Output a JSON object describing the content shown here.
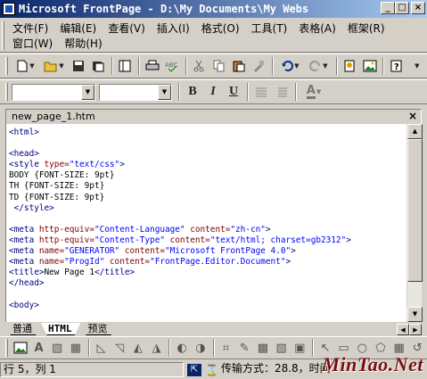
{
  "window": {
    "title": "Microsoft FrontPage - D:\\My Documents\\My Webs",
    "minimize": "_",
    "maximize": "□",
    "close": "×"
  },
  "menu": {
    "row1": [
      "文件(F)",
      "编辑(E)",
      "查看(V)",
      "插入(I)",
      "格式(O)",
      "工具(T)",
      "表格(A)",
      "框架(R)"
    ],
    "row2": [
      "窗口(W)",
      "帮助(H)"
    ]
  },
  "format_toolbar": {
    "bold": "B",
    "italic": "I",
    "underline": "U",
    "font_color": "A"
  },
  "document": {
    "tab_title": "new_page_1.htm",
    "close": "×"
  },
  "code_lines": [
    [
      [
        "tag",
        "<html>"
      ]
    ],
    [],
    [
      [
        "tag",
        "<head>"
      ]
    ],
    [
      [
        "tag",
        "<style "
      ],
      [
        "attr",
        "type="
      ],
      [
        "val",
        "\"text/css\""
      ],
      [
        "tag",
        ">"
      ]
    ],
    [
      [
        "txt",
        "BODY {FONT-SIZE: 9pt}"
      ]
    ],
    [
      [
        "txt",
        "TH {FONT-SIZE: 9pt}"
      ]
    ],
    [
      [
        "txt",
        "TD {FONT-SIZE: 9pt}"
      ]
    ],
    [
      [
        "tag",
        " </style>"
      ]
    ],
    [],
    [
      [
        "tag",
        "<meta "
      ],
      [
        "attr",
        "http-equiv="
      ],
      [
        "val",
        "\"Content-Language\""
      ],
      [
        "attr",
        " content="
      ],
      [
        "val",
        "\"zh-cn\""
      ],
      [
        "tag",
        ">"
      ]
    ],
    [
      [
        "tag",
        "<meta "
      ],
      [
        "attr",
        "http-equiv="
      ],
      [
        "val",
        "\"Content-Type\""
      ],
      [
        "attr",
        " content="
      ],
      [
        "val",
        "\"text/html; charset=gb2312\""
      ],
      [
        "tag",
        ">"
      ]
    ],
    [
      [
        "tag",
        "<meta "
      ],
      [
        "attr",
        "name="
      ],
      [
        "val",
        "\"GENERATOR\""
      ],
      [
        "attr",
        " content="
      ],
      [
        "val",
        "\"Microsoft FrontPage 4.0\""
      ],
      [
        "tag",
        ">"
      ]
    ],
    [
      [
        "tag",
        "<meta "
      ],
      [
        "attr",
        "name="
      ],
      [
        "val",
        "\"ProgId\""
      ],
      [
        "attr",
        " content="
      ],
      [
        "val",
        "\"FrontPage.Editor.Document\""
      ],
      [
        "tag",
        ">"
      ]
    ],
    [
      [
        "tag",
        "<title>"
      ],
      [
        "txt",
        "New Page 1"
      ],
      [
        "tag",
        "</title>"
      ]
    ],
    [
      [
        "tag",
        "</head>"
      ]
    ],
    [],
    [
      [
        "tag",
        "<body>"
      ]
    ]
  ],
  "view_tabs": [
    "普通",
    "HTML",
    "预览"
  ],
  "active_view": "HTML",
  "status": {
    "position": "行 5，列 1",
    "transfer": "传输方式：28.8，时间"
  },
  "watermark": "MinTao.Net"
}
